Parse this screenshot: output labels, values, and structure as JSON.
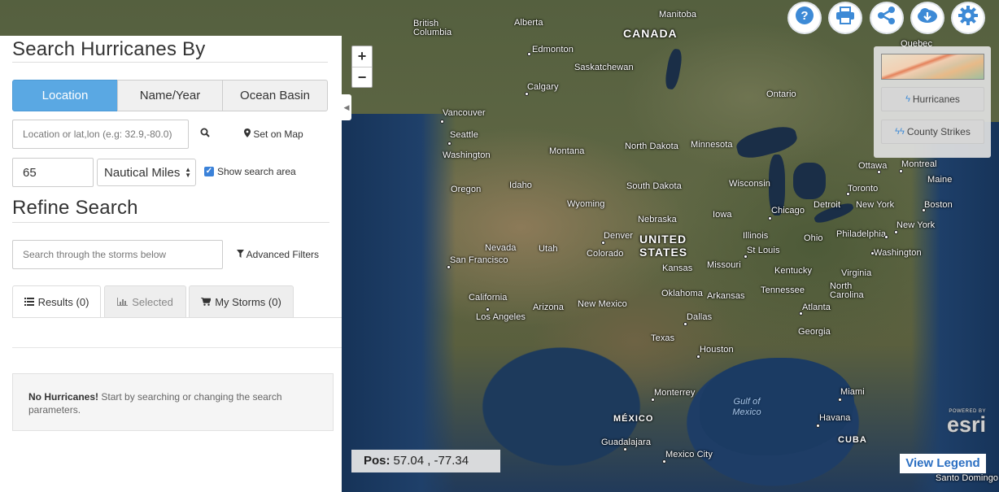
{
  "sidebar": {
    "heading": "Search Hurricanes By",
    "search_tabs": [
      "Location",
      "Name/Year",
      "Ocean Basin"
    ],
    "location_input": {
      "placeholder": "Location or lat,lon (e.g: 32.9,-80.0)",
      "value": ""
    },
    "set_on_map_label": "Set on Map",
    "radius_value": "65",
    "unit_selected": "Nautical Miles",
    "show_search_area_label": "Show search area",
    "show_search_area_checked": true,
    "refine_heading": "Refine Search",
    "storm_filter_placeholder": "Search through the storms below",
    "advanced_filters_label": "Advanced Filters",
    "result_tabs": [
      {
        "label": "Results (0)",
        "icon": "list-icon"
      },
      {
        "label": "Selected",
        "icon": "bar-chart-icon"
      },
      {
        "label": "My Storms (0)",
        "icon": "cart-icon"
      }
    ],
    "notice_bold": "No Hurricanes!",
    "notice_text": " Start by searching or changing the search parameters."
  },
  "toolbar": {
    "buttons": [
      "help-icon",
      "print-icon",
      "share-icon",
      "download-icon",
      "settings-icon"
    ]
  },
  "layers": {
    "hurricanes_label": "Hurricanes",
    "county_strikes_label": "County Strikes"
  },
  "map": {
    "zoom_in": "+",
    "zoom_out": "−",
    "position_label": "Pos:",
    "position_value": "57.04 , -77.34",
    "legend_label": "View Legend",
    "powered_by": "POWERED BY",
    "esri_logo": "esri",
    "labels": {
      "canada": "CANADA",
      "united_states": "UNITED STATES",
      "mexico": "MÉXICO",
      "cuba": "CUBA",
      "gulf": "Gulf of Mexico",
      "british_columbia": "British Columbia",
      "alberta": "Alberta",
      "manitoba": "Manitoba",
      "edmonton": "Edmonton",
      "saskatchewan": "Saskatchewan",
      "calgary": "Calgary",
      "ontario": "Ontario",
      "quebec": "Quebec",
      "vancouver": "Vancouver",
      "seattle": "Seattle",
      "washington": "Washington",
      "montana": "Montana",
      "north_dakota": "North Dakota",
      "minnesota": "Minnesota",
      "oregon": "Oregon",
      "idaho": "Idaho",
      "wyoming": "Wyoming",
      "south_dakota": "South Dakota",
      "wisconsin": "Wisconsin",
      "ottawa": "Ottawa",
      "montreal": "Montreal",
      "maine": "Maine",
      "toronto": "Toronto",
      "detroit": "Detroit",
      "new_york_city": "New York",
      "boston": "Boston",
      "chicago": "Chicago",
      "iowa": "Iowa",
      "nebraska": "Nebraska",
      "new_york_state": "New York",
      "nevada": "Nevada",
      "utah": "Utah",
      "denver": "Denver",
      "colorado": "Colorado",
      "illinois": "Illinois",
      "ohio": "Ohio",
      "philadelphia": "Philadelphia",
      "san_francisco": "San Francisco",
      "kansas": "Kansas",
      "missouri": "Missouri",
      "st_louis": "St Louis",
      "washington_dc": "Washington",
      "kentucky": "Kentucky",
      "virginia": "Virginia",
      "california": "California",
      "los_angeles": "Los Angeles",
      "arizona": "Arizona",
      "new_mexico": "New Mexico",
      "oklahoma": "Oklahoma",
      "arkansas": "Arkansas",
      "tennessee": "Tennessee",
      "north_carolina": "North Carolina",
      "dallas": "Dallas",
      "atlanta": "Atlanta",
      "texas": "Texas",
      "georgia": "Georgia",
      "houston": "Houston",
      "monterrey": "Monterrey",
      "miami": "Miami",
      "havana": "Havana",
      "guadalajara": "Guadalajara",
      "mexico_city": "Mexico City",
      "santo_domingo": "Santo Domingo"
    }
  }
}
